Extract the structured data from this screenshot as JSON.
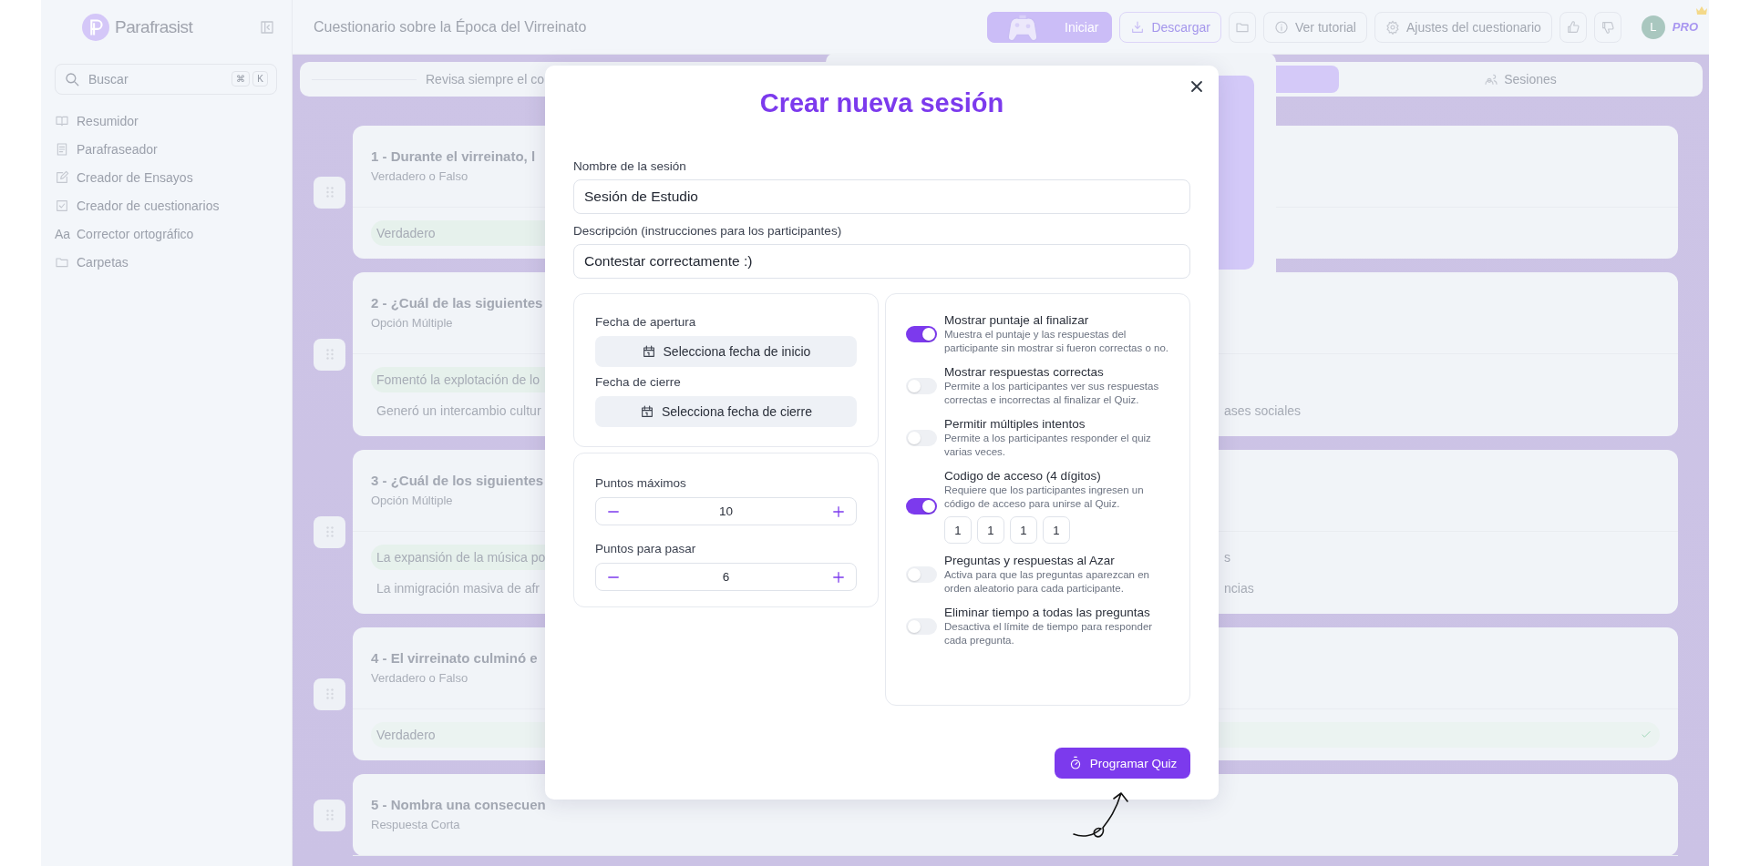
{
  "app": {
    "name": "Parafrasist"
  },
  "sidebar": {
    "search": {
      "placeholder": "Buscar",
      "shortcut": [
        "⌘",
        "K"
      ]
    },
    "items": [
      {
        "label": "Resumidor"
      },
      {
        "label": "Parafraseador"
      },
      {
        "label": "Creador de Ensayos"
      },
      {
        "label": "Creador de cuestionarios"
      },
      {
        "label": "Corrector ortográfico",
        "icon_text": "Aa"
      },
      {
        "label": "Carpetas"
      }
    ]
  },
  "header": {
    "title": "Cuestionario sobre la Época del Virreinato",
    "actions": [
      {
        "kind": "primary",
        "label": "Iniciar"
      },
      {
        "kind": "outline",
        "label": "Descargar"
      },
      {
        "kind": "icon"
      },
      {
        "kind": "plain",
        "label": "Ver tutorial"
      },
      {
        "kind": "plain",
        "label": "Ajustes del cuestionario"
      },
      {
        "kind": "icon"
      },
      {
        "kind": "icon"
      }
    ],
    "user": {
      "initial": "L",
      "plan": "PRO"
    }
  },
  "tabs": [
    {
      "label": "Revisa siempre el co",
      "selected": false
    },
    {
      "selected": true
    },
    {
      "label": "Sesiones",
      "selected": false
    }
  ],
  "questions": [
    {
      "title": "1 - Durante el virreinato, l",
      "type": "Verdadero o Falso",
      "options": [
        {
          "text": "Verdadero",
          "kind": "highlight"
        }
      ]
    },
    {
      "title": "2 - ¿Cuál de las siguientes",
      "type": "Opción Múltiple",
      "options": [
        {
          "text": "Fomentó la explotación de lo",
          "kind": "highlight"
        },
        {
          "text": "Generó un intercambio cultur",
          "tail": "ases sociales",
          "kind": "plain"
        }
      ]
    },
    {
      "title": "3 - ¿Cuál de los siguientes",
      "type": "Opción Múltiple",
      "options": [
        {
          "text": "La expansión de la música po",
          "tail": "s",
          "kind": "highlight"
        },
        {
          "text": "La inmigración masiva de afr",
          "tail": "ncias",
          "kind": "plain"
        }
      ]
    },
    {
      "title": "4 - El virreinato culminó e",
      "type": "Verdadero o Falso",
      "options": [
        {
          "text": "Verdadero",
          "kind": "checked"
        }
      ]
    },
    {
      "title": "5 - Nombra una consecuen",
      "type": "Respuesta Corta"
    }
  ],
  "modal": {
    "title": "Crear nueva sesión",
    "fields": [
      {
        "label": "Nombre de la sesión",
        "value": "Sesión de Estudio"
      },
      {
        "label": "Descripción (instrucciones para los participantes)",
        "value": "Contestar correctamente :)"
      }
    ],
    "dates": [
      {
        "label": "Fecha de apertura",
        "button": "Selecciona fecha de inicio"
      },
      {
        "label": "Fecha de cierre",
        "button": "Selecciona fecha de cierre"
      }
    ],
    "points": [
      {
        "label": "Puntos máximos",
        "value": "10"
      },
      {
        "label": "Puntos para pasar",
        "value": "6"
      }
    ],
    "settings": [
      {
        "title": "Mostrar puntaje al finalizar",
        "description": "Muestra el puntaje y las respuestas del participante sin mostrar si fueron correctas o no.",
        "on": true
      },
      {
        "title": "Mostrar respuestas correctas",
        "description": "Permite a los participantes ver sus respuestas correctas e incorrectas al finalizar el Quiz.",
        "on": false
      },
      {
        "title": "Permitir múltiples intentos",
        "description": "Permite a los participantes responder el quiz varias veces.",
        "on": false
      },
      {
        "title": "Codigo de acceso (4 dígitos)",
        "description": "Requiere que los participantes ingresen un código de acceso para unirse al Quiz.",
        "on": true,
        "code": [
          "1",
          "1",
          "1",
          "1"
        ]
      },
      {
        "title": "Preguntas y respuestas al Azar",
        "description": "Activa para que las preguntas aparezcan en orden aleatorio para cada participante.",
        "on": false
      },
      {
        "title": "Eliminar tiempo a todas las preguntas",
        "description": "Desactiva el límite de tiempo para responder cada pregunta.",
        "on": false
      }
    ],
    "submit": "Programar Quiz"
  }
}
